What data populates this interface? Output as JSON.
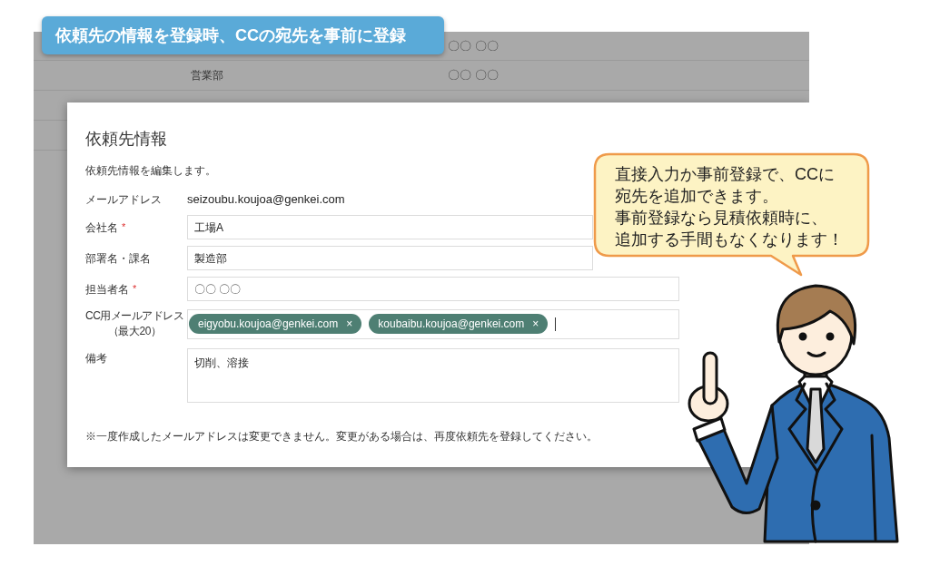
{
  "banner": {
    "title": "依頼先の情報を登録時、CCの宛先を事前に登録"
  },
  "background_table": {
    "rows": [
      {
        "column_3": "〇〇 〇〇"
      },
      {
        "column_2": "営業部",
        "column_3": "〇〇 〇〇"
      }
    ]
  },
  "dialog": {
    "title": "依頼先情報",
    "description": "依頼先情報を編集します。",
    "fields": [
      {
        "kind": "text",
        "label": "メールアドレス",
        "value": "seizoubu.koujoa@genkei.com"
      },
      {
        "kind": "input",
        "label": "会社名",
        "required_mark": "*",
        "value": "工場A"
      },
      {
        "kind": "input",
        "label": "部署名・課名",
        "value": "製造部"
      },
      {
        "kind": "input",
        "label": "担当者名",
        "required_mark": "*",
        "value": "〇〇 〇〇"
      },
      {
        "kind": "tags",
        "label_lines": [
          "CC用メールアドレス",
          "（最大20）"
        ],
        "tags": [
          {
            "text": "eigyobu.koujoa@genkei.com",
            "remove": "×"
          },
          {
            "text": "koubaibu.koujoa@genkei.com",
            "remove": "×"
          }
        ],
        "focused": true
      },
      {
        "kind": "textarea",
        "label": "備考",
        "value": "切削、溶接"
      }
    ],
    "note": "※一度作成したメールアドレスは変更できません。変更がある場合は、再度依頼先を登録してください。"
  },
  "callout": {
    "lines": [
      "直接入力か事前登録で、CCに",
      "宛先を追加できます。",
      "事前登録なら見積依頼時に、",
      "追加する手間もなくなります！"
    ]
  }
}
